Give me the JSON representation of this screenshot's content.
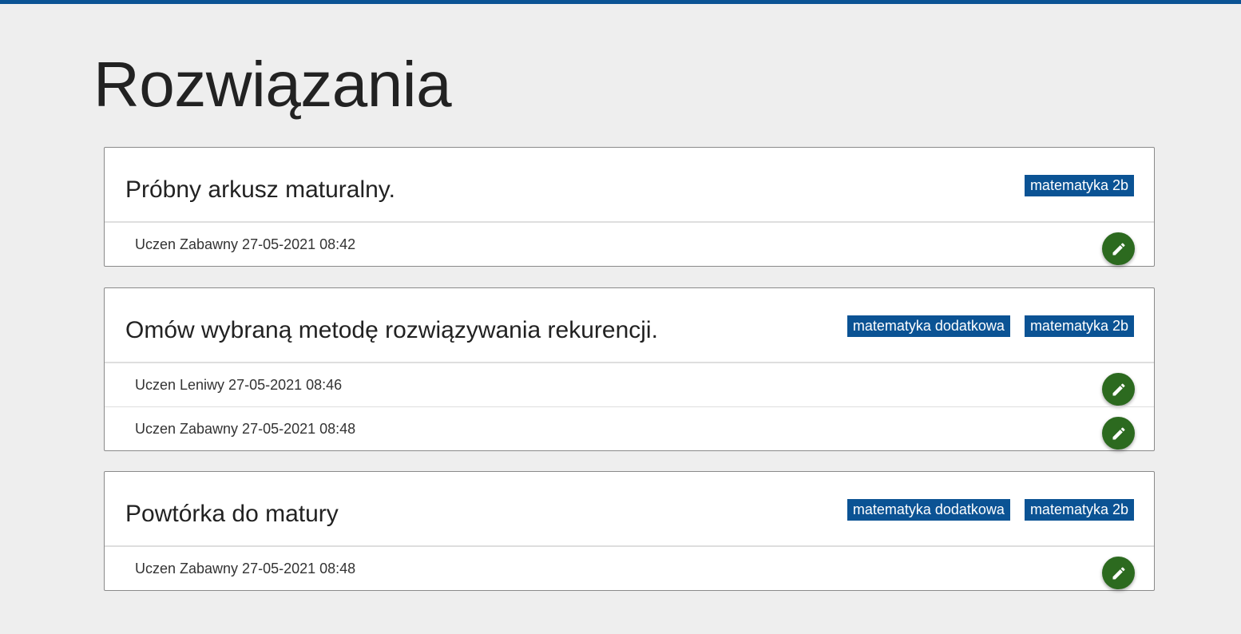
{
  "page": {
    "title": "Rozwiązania"
  },
  "colors": {
    "accent": "#0b5394",
    "edit_button": "#2c6a1f",
    "background": "#eeeeee"
  },
  "cards": [
    {
      "title": "Próbny arkusz maturalny.",
      "tags": [
        "matematyka 2b"
      ],
      "entries": [
        {
          "text": "Uczen Zabawny 27-05-2021 08:42",
          "action_icon": "pencil-icon"
        }
      ]
    },
    {
      "title": "Omów wybraną metodę rozwiązywania rekurencji.",
      "tags": [
        "matematyka dodatkowa",
        "matematyka 2b"
      ],
      "entries": [
        {
          "text": "Uczen Leniwy 27-05-2021 08:46",
          "action_icon": "pencil-icon"
        },
        {
          "text": "Uczen Zabawny 27-05-2021 08:48",
          "action_icon": "pencil-icon"
        }
      ]
    },
    {
      "title": "Powtórka do matury",
      "tags": [
        "matematyka dodatkowa",
        "matematyka 2b"
      ],
      "entries": [
        {
          "text": "Uczen Zabawny 27-05-2021 08:48",
          "action_icon": "pencil-icon"
        }
      ]
    }
  ]
}
